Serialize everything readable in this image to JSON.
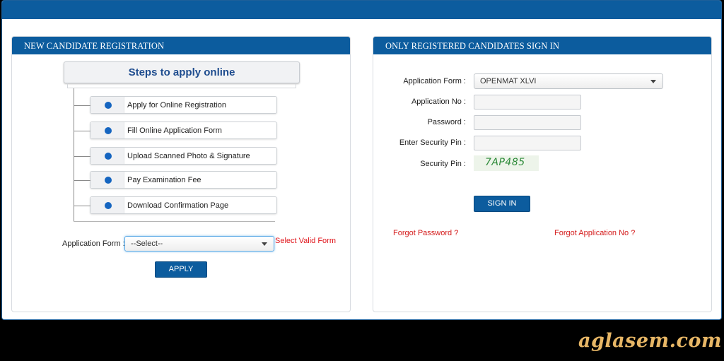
{
  "left_panel": {
    "header": "NEW CANDIDATE REGISTRATION",
    "steps_title": "Steps to apply online",
    "steps": [
      "Apply for Online Registration",
      "Fill Online Application Form",
      "Upload Scanned Photo & Signature",
      "Pay Examination Fee",
      "Download Confirmation Page"
    ],
    "form_label": "Application Form :",
    "form_select_value": "--Select--",
    "form_error": "Select Valid Form",
    "apply_label": "APPLY"
  },
  "right_panel": {
    "header": "ONLY REGISTERED CANDIDATES SIGN IN",
    "application_form_label": "Application Form :",
    "application_form_value": "OPENMAT XLVI",
    "application_no_label": "Application No :",
    "application_no_value": "",
    "password_label": "Password :",
    "password_value": "",
    "enter_pin_label": "Enter Security Pin :",
    "enter_pin_value": "",
    "security_pin_label": "Security Pin :",
    "security_pin_value": "7AP485",
    "signin_label": "SIGN IN",
    "forgot_password": "Forgot Password ?",
    "forgot_application_no": "Forgot Application No ?"
  },
  "watermark": "aglasem.com",
  "colors": {
    "header_blue": "#0c5c9e",
    "title_blue": "#1f4d8f",
    "bullet_blue": "#1565c0",
    "error_red": "#e0151b",
    "captcha_green": "#2e8b3a",
    "watermark_gold": "#e8b766"
  },
  "icons": {
    "select_caret": "chevron-down-icon",
    "step_bullet": "bullet-dot-icon"
  }
}
